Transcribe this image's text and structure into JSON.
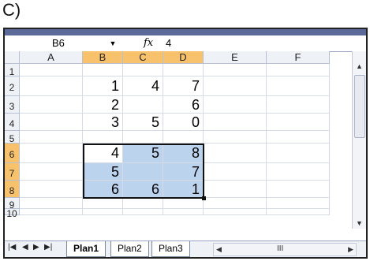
{
  "outer_label": "C)",
  "formula_bar": {
    "name_box": "B6",
    "dropdown_icon": "chevron-down-icon",
    "fx_label": "fx",
    "formula_value": "4"
  },
  "columns": [
    "A",
    "B",
    "C",
    "D",
    "E",
    "F"
  ],
  "selected_columns": [
    "B",
    "C",
    "D"
  ],
  "rows": [
    "1",
    "2",
    "3",
    "4",
    "5",
    "6",
    "7",
    "8",
    "9",
    "10"
  ],
  "selected_rows": [
    "6",
    "7",
    "8"
  ],
  "cells": {
    "B2": "1",
    "C2": "4",
    "D2": "7",
    "B3": "2",
    "D3": "6",
    "B4": "3",
    "C4": "5",
    "D4": "0",
    "B6": "4",
    "C6": "5",
    "D6": "8",
    "B7": "5",
    "D7": "7",
    "B8": "6",
    "C8": "6",
    "D8": "1"
  },
  "highlight_color": "#bcd3ee",
  "header_selected_color": "#f7c26b",
  "tabs": {
    "first": "Plan1",
    "second": "Plan2",
    "third": "Plan3",
    "active": "Plan1"
  },
  "tab_nav": {
    "first": "|◀",
    "prev": "◀",
    "next": "▶",
    "last": "▶|"
  },
  "scroll_grip": "III"
}
